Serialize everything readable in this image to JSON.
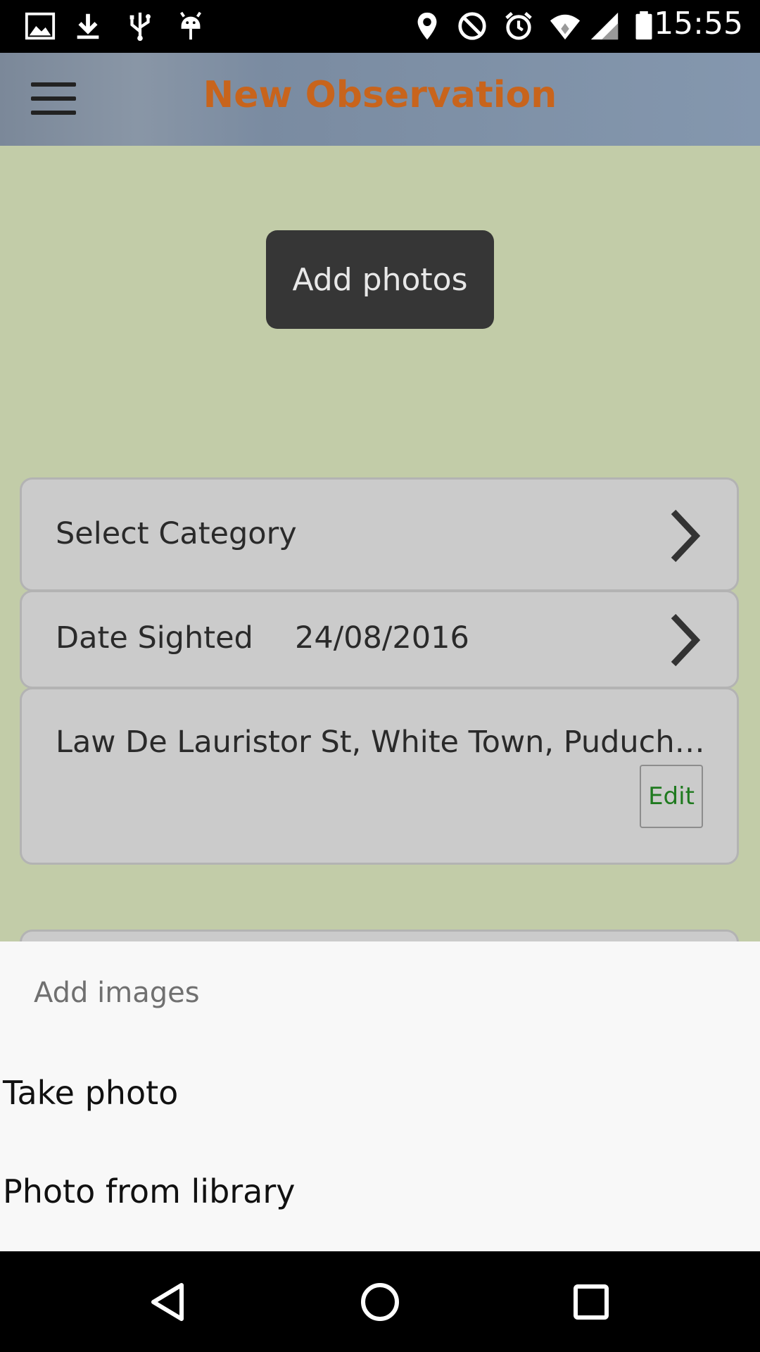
{
  "status_bar": {
    "time": "15:55",
    "left_icons": [
      "image-icon",
      "download-icon",
      "usb-icon",
      "android-debug-icon"
    ],
    "right_icons": [
      "location-icon",
      "do-not-disturb-icon",
      "alarm-icon",
      "wifi-icon",
      "cell-signal-icon",
      "battery-icon"
    ]
  },
  "header": {
    "title": "New Observation",
    "title_color": "#c8641c",
    "menu_icon": "hamburger-menu-icon"
  },
  "main": {
    "add_photos_label": "Add photos",
    "category_label": "Select Category",
    "date_label": "Date Sighted",
    "date_value": "24/08/2016",
    "location_text": "Law De Lauristor St, White Town, Puduch…",
    "edit_label": "Edit",
    "edit_color": "#1f7a1f"
  },
  "sheet": {
    "title": "Add images",
    "items": [
      {
        "label": "Take photo"
      },
      {
        "label": "Photo from library"
      }
    ]
  },
  "nav": {
    "icons": [
      "back-icon",
      "home-icon",
      "recents-icon"
    ]
  }
}
